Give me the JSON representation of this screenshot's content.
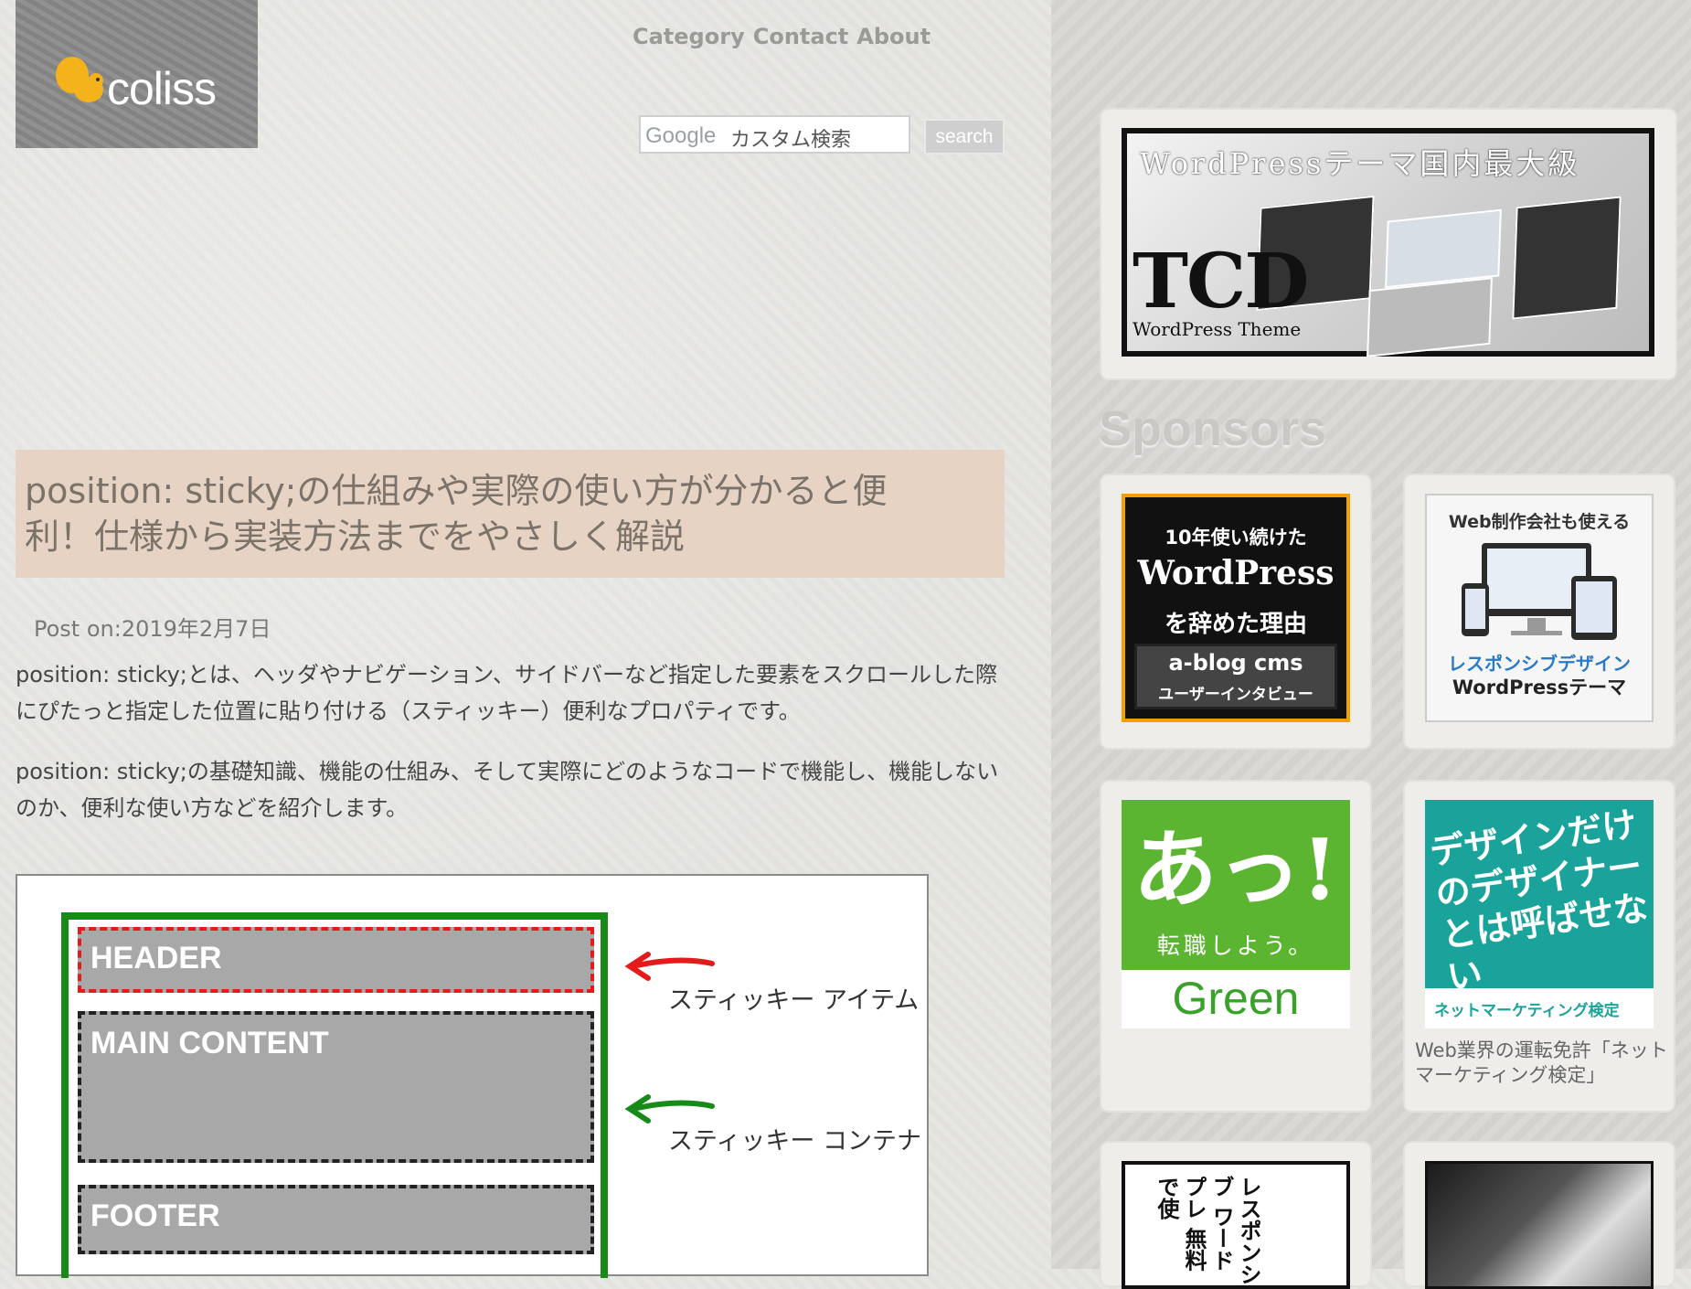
{
  "logo": {
    "text": "coliss"
  },
  "nav": {
    "items": [
      "Category",
      "Contact",
      "About"
    ]
  },
  "search": {
    "brand": "Google",
    "placeholder": "カスタム検索",
    "button": "search"
  },
  "article": {
    "title": "position: sticky;の仕組みや実際の使い方が分かると便利！仕様から実装方法までをやさしく解説",
    "post_on": "Post on:2019年2月7日",
    "paragraphs": [
      "position: sticky;とは、ヘッダやナビゲーション、サイドバーなど指定した要素をスクロールした際にぴたっと指定した位置に貼り付ける（スティッキー）便利なプロパティです。",
      "position: sticky;の基礎知識、機能の仕組み、そして実際にどのようなコードで機能し、機能しないのか、便利な使い方などを紹介します。"
    ],
    "figure": {
      "header": "HEADER",
      "main": "MAIN CONTENT",
      "footer": "FOOTER",
      "label_item": "スティッキー アイテム",
      "label_container": "スティッキー コンテナ"
    }
  },
  "sidebar": {
    "tcd": {
      "headline": "WordPressテーマ国内最大級",
      "big": "TCD",
      "small": "WordPress Theme"
    },
    "sponsors_heading": "Sponsors",
    "ads": {
      "blog": {
        "line1": "10年使い続けた",
        "line2": "WordPress",
        "line3": "を辞めた理由",
        "brand": "a-blog cms",
        "sub": "ユーザーインタビュー"
      },
      "resp": {
        "line1": "Web制作会社も使える",
        "line2": "レスポンシブデザイン",
        "line3": "WordPressテーマ"
      },
      "green": {
        "big": "あっ!",
        "tagline": "転職しよう。",
        "brand": "Green"
      },
      "teal": {
        "text": "デザインだけのデザイナーとは呼ばせない",
        "foot": "ネットマーケティング検定",
        "caption": "Web業界の運転免許「ネットマーケティング検定」"
      },
      "manga": {
        "text": "レスポンシブ ワードプレ 無料で使"
      }
    }
  },
  "colors": {
    "title_bg": "#e6d3c3",
    "container_border": "#178a17",
    "header_border": "#e51b1b",
    "green_ad": "#5cb531",
    "teal_ad": "#1aa39b"
  }
}
